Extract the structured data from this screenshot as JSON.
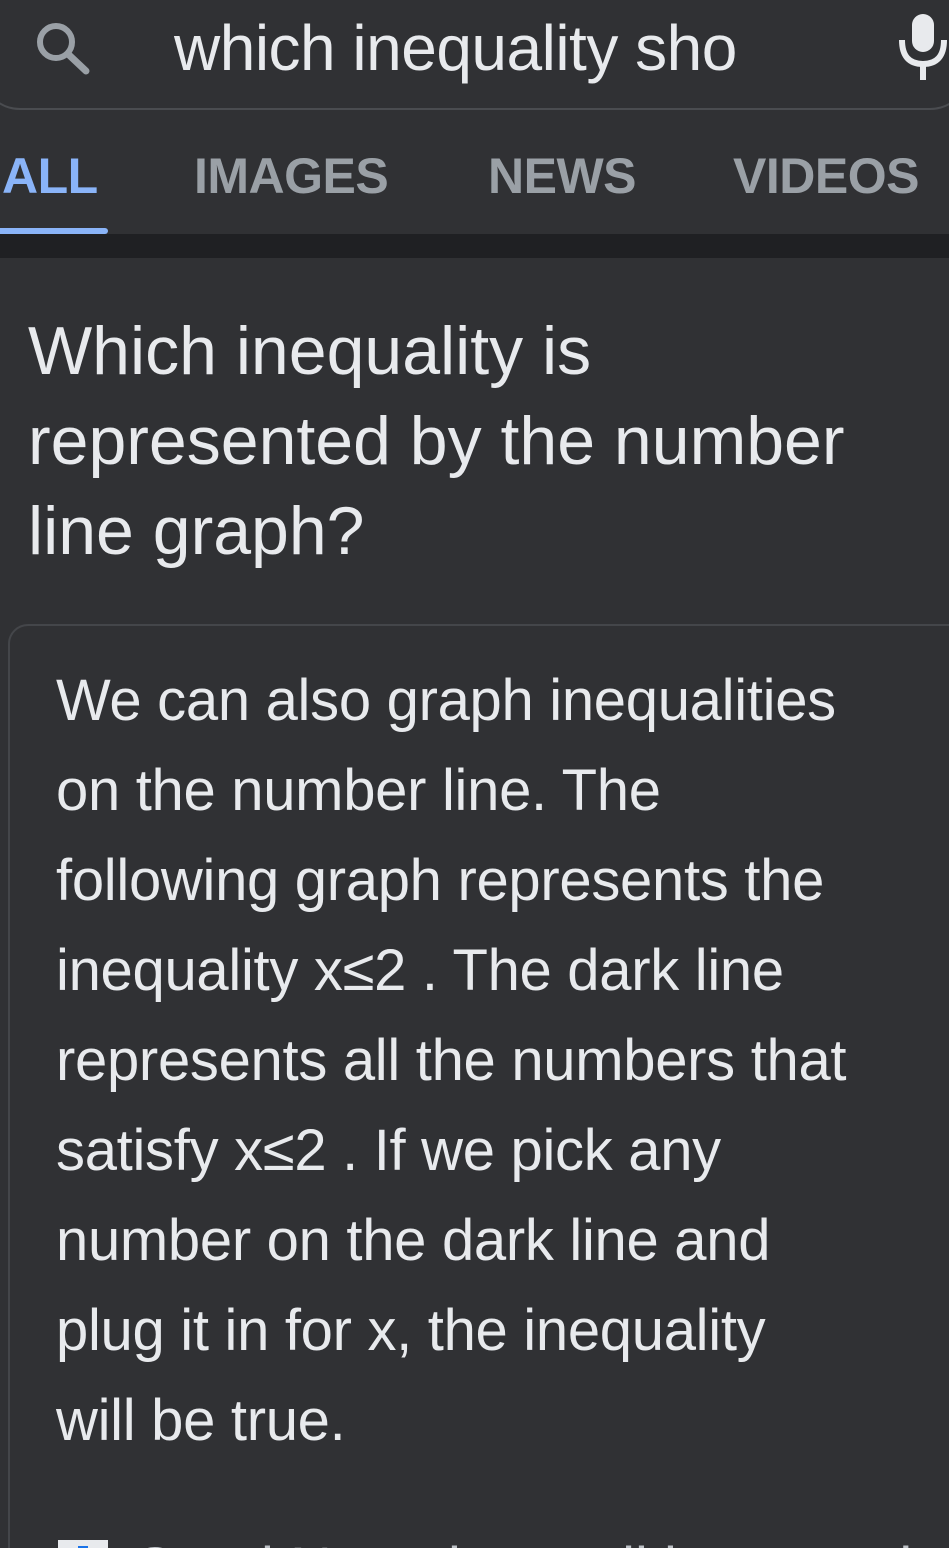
{
  "search": {
    "query": "which inequality sho"
  },
  "tabs": [
    {
      "label": "ALL",
      "active": true
    },
    {
      "label": "IMAGES",
      "active": false
    },
    {
      "label": "NEWS",
      "active": false
    },
    {
      "label": "VIDEOS",
      "active": false
    }
  ],
  "question": {
    "lines": [
      "Which inequality is",
      "represented by the number",
      "line graph?"
    ]
  },
  "answer": {
    "lines": [
      "We can also graph inequalities",
      "on the number line. The",
      "following graph represents the",
      "inequality x≤2 . The dark line",
      "represents all the numbers that",
      "satisfy x≤2 . If we pick any",
      "number on the dark line and",
      "plug it in for x, the inequality",
      "will be true."
    ]
  },
  "source": {
    "text": "Good Nutra inequalities equation"
  },
  "colors": {
    "background": "#303134",
    "accent": "#8ab4f8",
    "text": "#e8eaed",
    "muted": "#9aa0a6"
  },
  "icons": {
    "search": "search-icon",
    "mic": "mic-icon"
  }
}
